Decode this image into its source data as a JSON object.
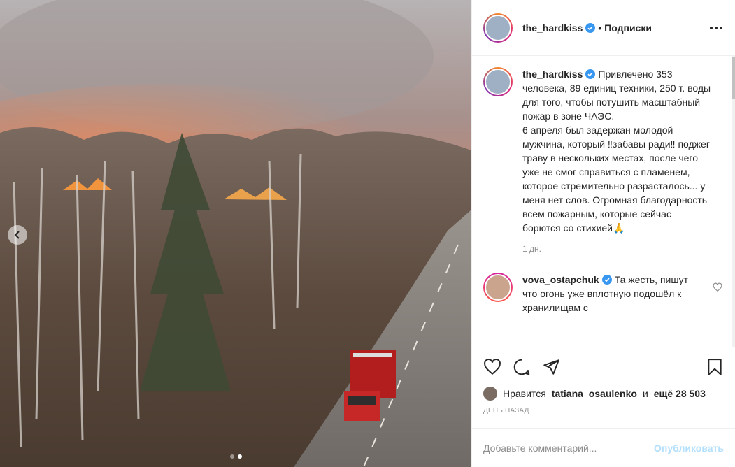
{
  "post": {
    "author": "the_hardkiss",
    "follow_status": "• Подписки",
    "caption": "Привлечено 353 человека, 89 единиц техники, 250 т. воды для того, чтобы потушить масштабный пожар в зоне ЧАЭС.\n6 апреля был задержан молодой мужчина, который ‼забавы ради‼ поджег траву в нескольких местах, после чего уже не смог справиться с пламенем, которое стремительно разрасталось... у меня нет слов. Огромная благодарность всем пожарным, которые сейчас борются со стихией🙏",
    "caption_time": "1 дн.",
    "likes_prefix": "Нравится",
    "liked_by": "tatiana_osaulenko",
    "likes_joiner": "и",
    "likes_rest": "ещё 28 503",
    "posted_ago": "ДЕНЬ НАЗАД"
  },
  "comments": [
    {
      "author": "vova_ostapchuk",
      "text": "Та жесть, пишут что огонь уже вплотную подошёл к хранилищам с"
    }
  ],
  "composer": {
    "placeholder": "Добавьте комментарий...",
    "publish_label": "Опубликовать"
  },
  "carousel": {
    "total": 2,
    "current": 2
  },
  "icons": {
    "verified": "verified-badge-icon",
    "like": "heart-icon",
    "comment": "comment-bubble-icon",
    "share": "paper-plane-icon",
    "save": "bookmark-icon",
    "more": "more-dots-icon",
    "prev": "chevron-left-icon"
  },
  "colors": {
    "verified": "#3897f0",
    "publish_disabled": "#b2dffc",
    "secondary_text": "#8e8e8e",
    "border": "#efefef"
  }
}
